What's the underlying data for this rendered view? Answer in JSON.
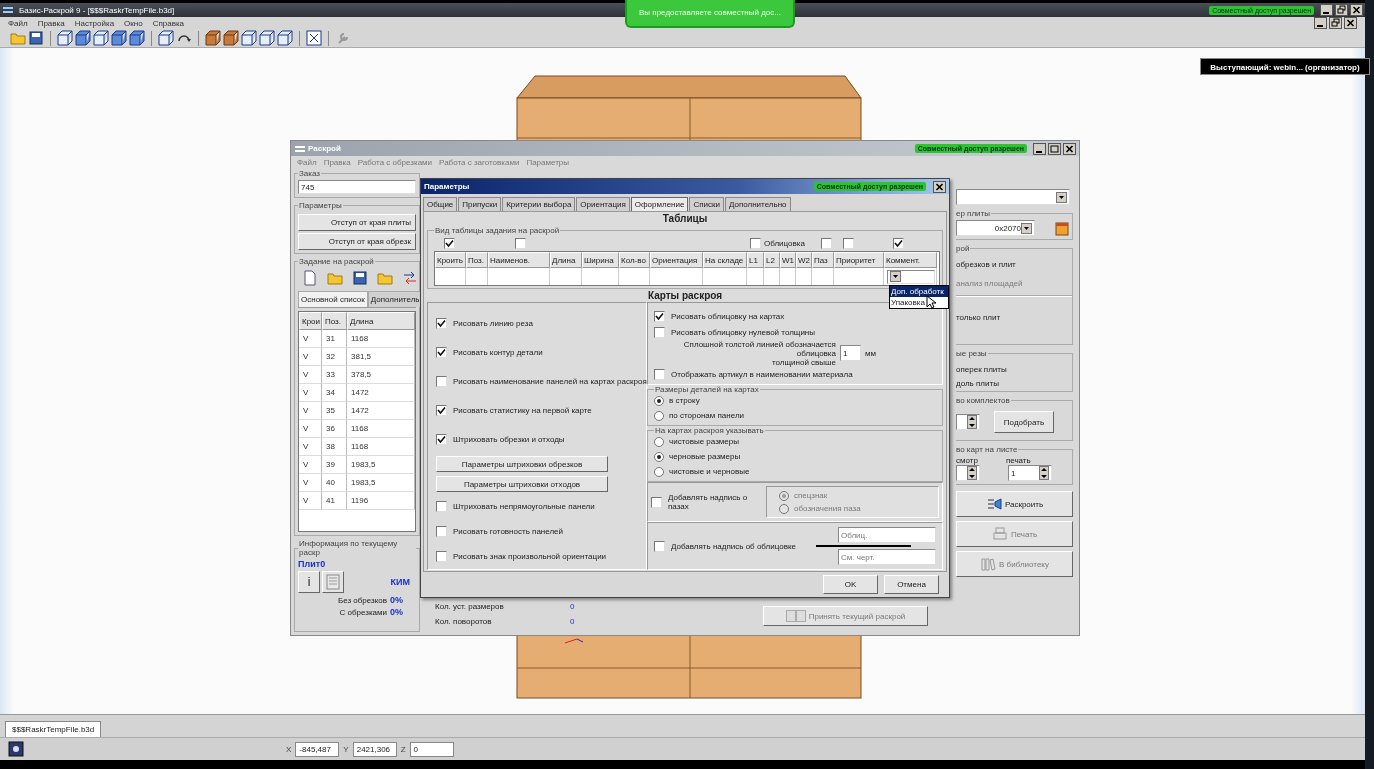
{
  "app": {
    "title": "Базис-Раскрой 9 - [$$$RaskrTempFile.b3d]",
    "share_badge": "Совместный доступ разрешен",
    "menu": [
      "Файл",
      "Правка",
      "Настройка",
      "Окно",
      "Справка"
    ],
    "share_banner": "Вы предоставляете совместный дос...",
    "presenter": "Выступающий: webin... (организатор)",
    "document_tabs": [
      {
        "label": "$$$RaskrTempFile.b3d",
        "selected": true
      }
    ],
    "coordinates": [
      {
        "axis": "X",
        "value": "-845,487"
      },
      {
        "axis": "Y",
        "value": "2421,306"
      },
      {
        "axis": "Z",
        "value": "0"
      }
    ]
  },
  "cutting_window": {
    "title": "Раскрой",
    "share_badge": "Совместный доступ разрешен",
    "menu": [
      "Файл",
      "Правка",
      "Работа с обрезками",
      "Работа с заготовками",
      "Параметры"
    ],
    "order": {
      "label": "Заказ",
      "value": "745"
    },
    "parameters": {
      "label": "Параметры",
      "buttons": [
        "Отступ от края плиты",
        "Отступ от края обрезк"
      ]
    },
    "task": {
      "label": "Задание на раскрой",
      "tabs": [
        {
          "label": "Основной список",
          "selected": true
        },
        {
          "label": "Дополнитель",
          "selected": false
        }
      ],
      "columns": [
        "Крои",
        "Поз.",
        "Длина"
      ],
      "rows": [
        [
          "V",
          "31",
          "1168"
        ],
        [
          "V",
          "32",
          "381,5"
        ],
        [
          "V",
          "33",
          "378,5"
        ],
        [
          "V",
          "34",
          "1472"
        ],
        [
          "V",
          "35",
          "1472"
        ],
        [
          "V",
          "36",
          "1168"
        ],
        [
          "V",
          "38",
          "1168"
        ],
        [
          "V",
          "39",
          "1983,5"
        ],
        [
          "V",
          "40",
          "1983,5"
        ],
        [
          "V",
          "41",
          "1196"
        ]
      ]
    },
    "info": {
      "label": "Информация по текущему раскр",
      "plates_label": "Плит",
      "plates_value": "0",
      "info_button": "i",
      "kim_label": "КИМ",
      "stats": [
        {
          "label": "Без обрезков",
          "value": "0%"
        },
        {
          "label": "С обрезками",
          "value": "0%"
        }
      ]
    },
    "counters": [
      {
        "label": "Кол. уст. размеров",
        "value": "0"
      },
      {
        "label": "Кол. поворотов",
        "value": "0"
      }
    ],
    "accept_button": {
      "label": "Принять текущий раскрой",
      "disabled": true
    },
    "sheet_size": {
      "label": "ер плиты",
      "value": "0x2070"
    },
    "cutting_mode": {
      "label": "рой",
      "options": [
        {
          "label": "обрезков и плит",
          "disabled": false
        },
        {
          "label": "анализ площадей",
          "disabled": true
        },
        {
          "label": "только плит",
          "disabled": false
        }
      ]
    },
    "cuts": {
      "label": "ые резы",
      "options": [
        "оперек плиты",
        "доль плиты"
      ]
    },
    "sets": {
      "label": "во комплектов",
      "button": "Подобрать"
    },
    "maps_per_sheet": {
      "label": "во карт на листе",
      "view_label": "смотр",
      "print_label": "печать",
      "print_value": "1"
    },
    "actions": [
      {
        "label": "Раскроить",
        "disabled": false
      },
      {
        "label": "Печать",
        "disabled": true
      },
      {
        "label": "В библиотеку",
        "disabled": true
      }
    ]
  },
  "params_dialog": {
    "title": "Параметры",
    "share_badge": "Совместный доступ разрешен",
    "tabs": [
      {
        "label": "Общие",
        "selected": false
      },
      {
        "label": "Припуски",
        "selected": false
      },
      {
        "label": "Критерии выбора",
        "selected": false
      },
      {
        "label": "Ориентация",
        "selected": false
      },
      {
        "label": "Оформление",
        "selected": true
      },
      {
        "label": "Списки",
        "selected": false
      },
      {
        "label": "Дополнительно",
        "selected": false
      }
    ],
    "tables_heading": "Таблицы",
    "table_view": {
      "label": "Вид таблицы задания на раскрой",
      "columns": [
        {
          "label": "Кроить",
          "toggle": {
            "checked": true
          }
        },
        {
          "label": "Поз."
        },
        {
          "label": "Наименов.",
          "toggle": {
            "checked": false
          }
        },
        {
          "label": "Длина"
        },
        {
          "label": "Ширина"
        },
        {
          "label": "Кол-во"
        },
        {
          "label": "Ориентация"
        },
        {
          "label": "На складе"
        },
        {
          "label": "L1",
          "toggle": {
            "checked": false,
            "label": "Облицовка"
          }
        },
        {
          "label": "L2"
        },
        {
          "label": "W1"
        },
        {
          "label": "W2"
        },
        {
          "label": "Паз",
          "toggle": {
            "checked": false
          }
        },
        {
          "label": "Приоритет",
          "toggle": {
            "checked": false
          }
        },
        {
          "label": "Коммент.",
          "toggle": {
            "checked": true
          }
        }
      ],
      "comment_options": [
        {
          "label": "Доп. обработк",
          "selected": true
        },
        {
          "label": "Упаковка",
          "selected": false
        }
      ]
    },
    "maps_heading": "Карты раскроя",
    "left_options": [
      {
        "kind": "checkbox",
        "label": "Рисовать линию реза",
        "checked": true
      },
      {
        "kind": "checkbox",
        "label": "Рисовать контур детали",
        "checked": true
      },
      {
        "kind": "checkbox",
        "label": "Рисовать наименование панелей на картах раскроя",
        "checked": false
      },
      {
        "kind": "checkbox",
        "label": "Рисовать статистику на первой карте",
        "checked": true
      },
      {
        "kind": "checkbox",
        "label": "Штриховать обрезки и отходы",
        "checked": true
      },
      {
        "kind": "button",
        "label": "Параметры штриховки обрезков"
      },
      {
        "kind": "button",
        "label": "Параметры штриховки отходов"
      },
      {
        "kind": "checkbox",
        "label": "Штриховать непрямоугольные панели",
        "checked": false
      },
      {
        "kind": "checkbox",
        "label": "Рисовать готовность панелей",
        "checked": false
      },
      {
        "kind": "checkbox",
        "label": "Рисовать знак произвольной ориентации",
        "checked": false
      }
    ],
    "right_options": [
      {
        "kind": "checkbox",
        "label": "Рисовать облицовку на картах",
        "checked": true
      },
      {
        "kind": "checkbox",
        "label": "Рисовать облицовку нулевой толщины",
        "checked": false
      },
      {
        "kind": "number",
        "label": "Сплошной толстой линией обозначается облицовка\nтолщиной свыше",
        "value": "1",
        "unit": "мм"
      },
      {
        "kind": "checkbox",
        "label": "Отображать артикул в наименовании материала",
        "checked": false
      }
    ],
    "part_sizes": {
      "label": "Размеры деталей на картах",
      "options": [
        {
          "label": "в строку",
          "selected": true
        },
        {
          "label": "по сторонам панели",
          "selected": false
        }
      ]
    },
    "show_on_maps": {
      "label": "На картах раскроя указывать",
      "options": [
        {
          "label": "чистовые размеры",
          "selected": false
        },
        {
          "label": "черновые размеры",
          "selected": true
        },
        {
          "label": "чистовые и черновые",
          "selected": false
        }
      ]
    },
    "groove_note": {
      "label": "Добавлять надпись о пазах",
      "checked": false,
      "options": [
        {
          "label": "спецзнак",
          "selected": true
        },
        {
          "label": "обозначения паза",
          "selected": false
        }
      ]
    },
    "facing_note": {
      "label": "Добавлять надпись об облицовке",
      "checked": false,
      "values": [
        "Облиц.",
        "См. черт."
      ]
    },
    "buttons": [
      "OK",
      "Отмена"
    ]
  }
}
